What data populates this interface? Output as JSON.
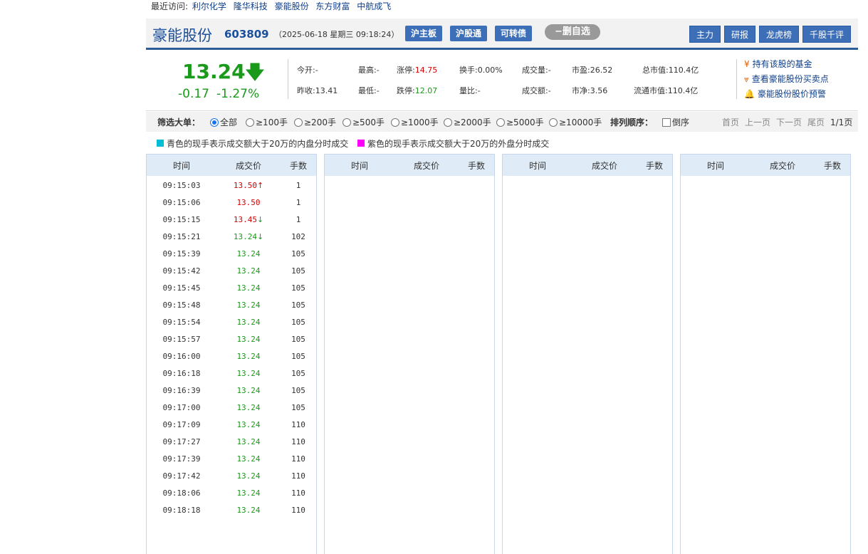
{
  "recent": {
    "label": "最近访问:",
    "links": [
      "利尔化学",
      "隆华科技",
      "豪能股份",
      "东方财富",
      "中航成飞"
    ]
  },
  "header": {
    "name": "豪能股份",
    "code": "603809",
    "datetime": "（2025-06-18 星期三 09:18:24）",
    "tags": [
      "沪主板",
      "沪股通",
      "可转债"
    ],
    "remove_fav": "−删自选",
    "right_buttons": [
      "主力",
      "研报",
      "龙虎榜",
      "千股千评"
    ]
  },
  "quote": {
    "price": "13.24",
    "price_arrow": "🡇",
    "change": "-0.17",
    "change_pct": "-1.27%",
    "open_label": "今开:",
    "open": "-",
    "prev_label": "昨收:",
    "prev": "13.41",
    "high_label": "最高:",
    "high": "-",
    "low_label": "最低:",
    "low": "-",
    "limit_up_label": "涨停:",
    "limit_up": "14.75",
    "limit_down_label": "跌停:",
    "limit_down": "12.07",
    "turnover_label": "换手:",
    "turnover": "0.00%",
    "vol_ratio_label": "量比:",
    "vol_ratio": "-",
    "volume_label": "成交量:",
    "volume": "-",
    "amount_label": "成交额:",
    "amount": "-",
    "pe_label": "市盈:",
    "pe": "26.52",
    "pb_label": "市净:",
    "pb": "3.56",
    "mktcap_label": "总市值:",
    "mktcap": "110.4亿",
    "float_cap_label": "流通市值:",
    "float_cap": "110.4亿",
    "links": [
      {
        "icon": "¥",
        "text": "持有该股的基金"
      },
      {
        "icon": "⩔",
        "text": "查看豪能股份买卖点"
      },
      {
        "icon": "🔔",
        "text": "豪能股份股价预警"
      }
    ]
  },
  "filter": {
    "label": "筛选大单：",
    "options": [
      "全部",
      "≥100手",
      "≥200手",
      "≥500手",
      "≥1000手",
      "≥2000手",
      "≥5000手",
      "≥10000手"
    ],
    "selected": "全部",
    "sort_label": "排列顺序：",
    "sort_option": "倒序",
    "pager": [
      "首页",
      "上一页",
      "下一页",
      "尾页"
    ],
    "page_info": "1/1页"
  },
  "legend": {
    "cyan": {
      "color": "#00bcd4",
      "text": "青色的现手表示成交额大于20万的内盘分时成交"
    },
    "magenta": {
      "color": "#ff00ff",
      "text": "紫色的现手表示成交额大于20万的外盘分时成交"
    }
  },
  "table": {
    "headers": [
      "时间",
      "成交价",
      "手数"
    ],
    "rows": [
      {
        "time": "09:15:03",
        "price": "13.50",
        "arrow": "↑",
        "dir": "up",
        "vol": "1"
      },
      {
        "time": "09:15:06",
        "price": "13.50",
        "arrow": "",
        "dir": "up",
        "vol": "1"
      },
      {
        "time": "09:15:15",
        "price": "13.45",
        "arrow": "↓",
        "dir": "up",
        "vol": "1"
      },
      {
        "time": "09:15:21",
        "price": "13.24",
        "arrow": "↓",
        "dir": "dn",
        "vol": "102"
      },
      {
        "time": "09:15:39",
        "price": "13.24",
        "arrow": "",
        "dir": "dn",
        "vol": "105"
      },
      {
        "time": "09:15:42",
        "price": "13.24",
        "arrow": "",
        "dir": "dn",
        "vol": "105"
      },
      {
        "time": "09:15:45",
        "price": "13.24",
        "arrow": "",
        "dir": "dn",
        "vol": "105"
      },
      {
        "time": "09:15:48",
        "price": "13.24",
        "arrow": "",
        "dir": "dn",
        "vol": "105"
      },
      {
        "time": "09:15:54",
        "price": "13.24",
        "arrow": "",
        "dir": "dn",
        "vol": "105"
      },
      {
        "time": "09:15:57",
        "price": "13.24",
        "arrow": "",
        "dir": "dn",
        "vol": "105"
      },
      {
        "time": "09:16:00",
        "price": "13.24",
        "arrow": "",
        "dir": "dn",
        "vol": "105"
      },
      {
        "time": "09:16:18",
        "price": "13.24",
        "arrow": "",
        "dir": "dn",
        "vol": "105"
      },
      {
        "time": "09:16:39",
        "price": "13.24",
        "arrow": "",
        "dir": "dn",
        "vol": "105"
      },
      {
        "time": "09:17:00",
        "price": "13.24",
        "arrow": "",
        "dir": "dn",
        "vol": "105"
      },
      {
        "time": "09:17:09",
        "price": "13.24",
        "arrow": "",
        "dir": "dn",
        "vol": "110"
      },
      {
        "time": "09:17:27",
        "price": "13.24",
        "arrow": "",
        "dir": "dn",
        "vol": "110"
      },
      {
        "time": "09:17:39",
        "price": "13.24",
        "arrow": "",
        "dir": "dn",
        "vol": "110"
      },
      {
        "time": "09:17:42",
        "price": "13.24",
        "arrow": "",
        "dir": "dn",
        "vol": "110"
      },
      {
        "time": "09:18:06",
        "price": "13.24",
        "arrow": "",
        "dir": "dn",
        "vol": "110"
      },
      {
        "time": "09:18:18",
        "price": "13.24",
        "arrow": "",
        "dir": "dn",
        "vol": "110"
      }
    ]
  }
}
